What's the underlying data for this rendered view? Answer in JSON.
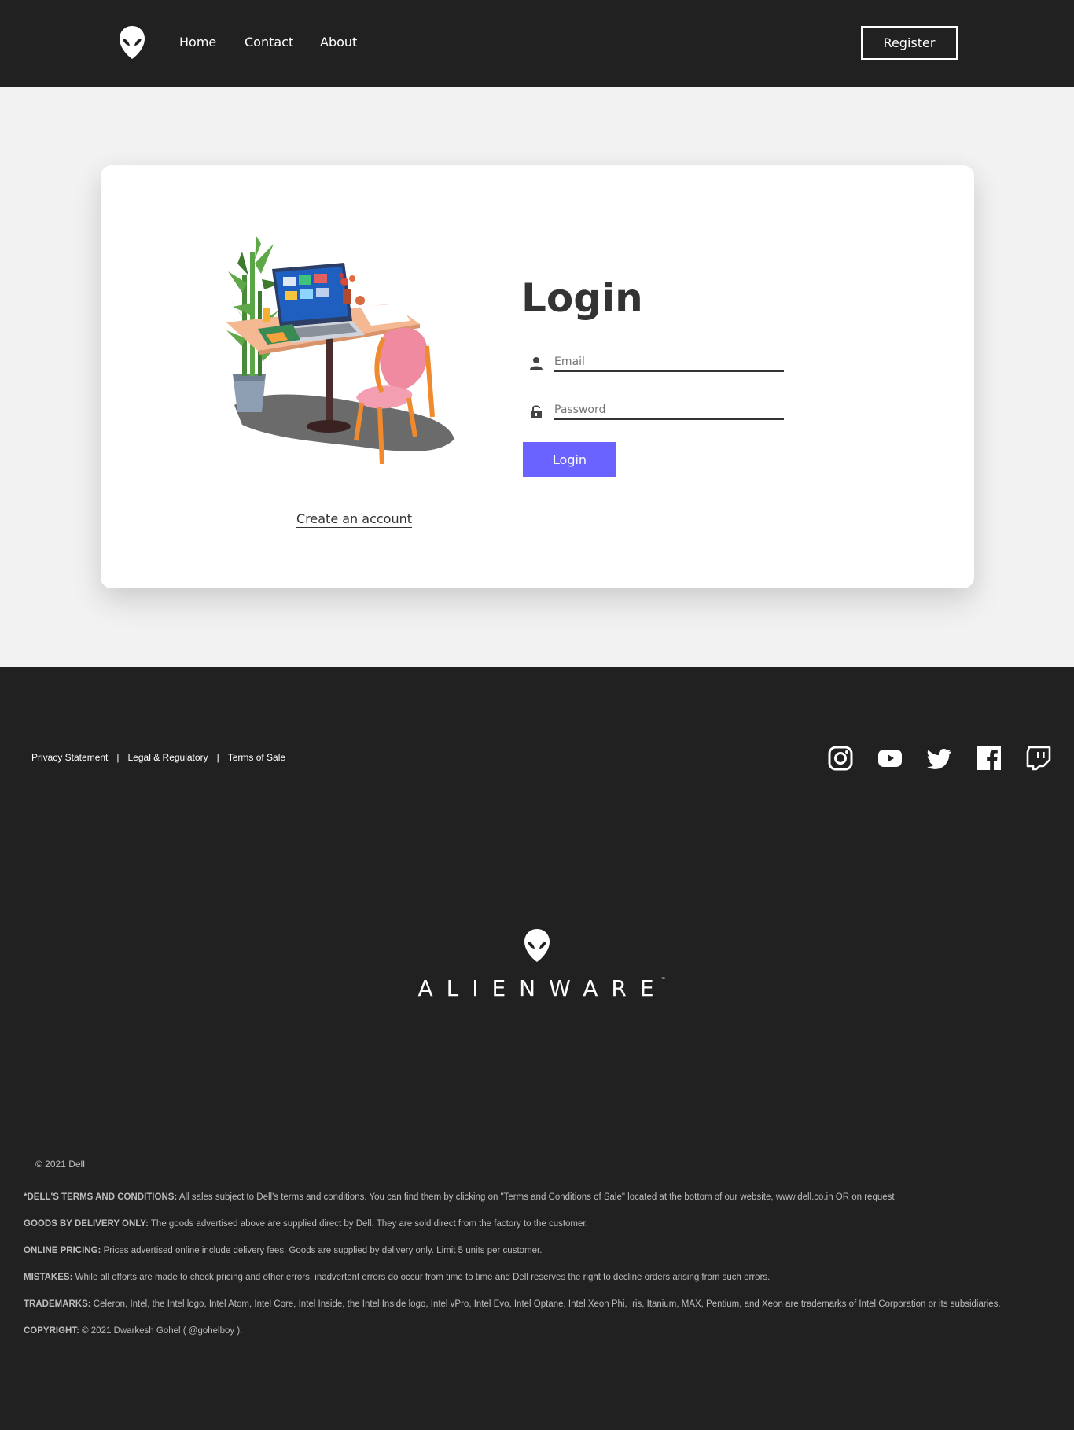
{
  "header": {
    "nav": [
      "Home",
      "Contact",
      "About"
    ],
    "register_label": "Register"
  },
  "login": {
    "title": "Login",
    "email_placeholder": "Email",
    "password_placeholder": "Password",
    "button_label": "Login",
    "create_account": "Create an account",
    "accent_color": "#6b63ff"
  },
  "footer": {
    "links": [
      "Privacy Statement",
      "Legal & Regulatory",
      "Terms of Sale"
    ],
    "separator": "|",
    "social_icons": [
      "instagram-icon",
      "youtube-icon",
      "twitter-icon",
      "facebook-icon",
      "twitch-icon"
    ],
    "brand": "ALIENWARE",
    "brand_tm": "™",
    "copyright_year": "© 2021 Dell",
    "legal": [
      {
        "label": "*DELL'S TERMS AND CONDITIONS:",
        "text": " All sales subject to Dell's terms and conditions. You can find them by clicking on \"Terms and Conditions of Sale\" located at the bottom of our website, www.dell.co.in OR on request"
      },
      {
        "label": "GOODS BY DELIVERY ONLY:",
        "text": " The goods advertised above are supplied direct by Dell. They are sold direct from the factory to the customer."
      },
      {
        "label": "ONLINE PRICING:",
        "text": " Prices advertised online include delivery fees. Goods are supplied by delivery only. Limit 5 units per customer."
      },
      {
        "label": "MISTAKES:",
        "text": " While all efforts are made to check pricing and other errors, inadvertent errors do occur from time to time and Dell reserves the right to decline orders arising from such errors."
      },
      {
        "label": "TRADEMARKS:",
        "text": " Celeron, Intel, the Intel logo, Intel Atom, Intel Core, Intel Inside, the Intel Inside logo, Intel vPro, Intel Evo, Intel Optane, Intel Xeon Phi, Iris, Itanium, MAX, Pentium, and Xeon are trademarks of Intel Corporation or its subsidiaries."
      },
      {
        "label": "COPYRIGHT:",
        "text": " © 2021 Dwarkesh Gohel ( @gohelboy )."
      }
    ]
  }
}
